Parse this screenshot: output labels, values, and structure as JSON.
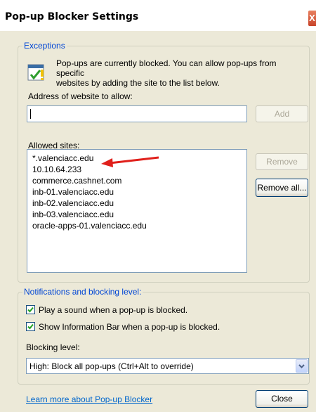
{
  "window": {
    "title": "Pop-up Blocker Settings",
    "close_glyph": "X"
  },
  "exceptions": {
    "legend": "Exceptions",
    "info_line1": "Pop-ups are currently blocked.  You can allow pop-ups from specific",
    "info_line2": "websites by adding the site to the list below.",
    "address_label": "Address of website to allow:",
    "address_value": "",
    "add_button": "Add",
    "allowed_label": "Allowed sites:",
    "allowed_sites": [
      "*.valenciacc.edu",
      "10.10.64.233",
      "commerce.cashnet.com",
      "inb-01.valenciacc.edu",
      "inb-02.valenciacc.edu",
      "inb-03.valenciacc.edu",
      "oracle-apps-01.valenciacc.edu"
    ],
    "remove_button": "Remove",
    "remove_all_button": "Remove all..."
  },
  "notifications": {
    "legend": "Notifications and blocking level:",
    "play_sound": {
      "label": "Play a sound when a pop-up is blocked.",
      "checked": true
    },
    "info_bar": {
      "label": "Show Information Bar when a pop-up is blocked.",
      "checked": true
    },
    "blocking_label": "Blocking level:",
    "blocking_value": "High: Block all pop-ups (Ctrl+Alt to override)"
  },
  "footer": {
    "learn_more": "Learn more about Pop-up Blocker",
    "close_button": "Close"
  },
  "colors": {
    "legend": "#0046d5",
    "link": "#0066cc",
    "arrow": "#e0201b",
    "window_bg": "#ece9d8"
  }
}
